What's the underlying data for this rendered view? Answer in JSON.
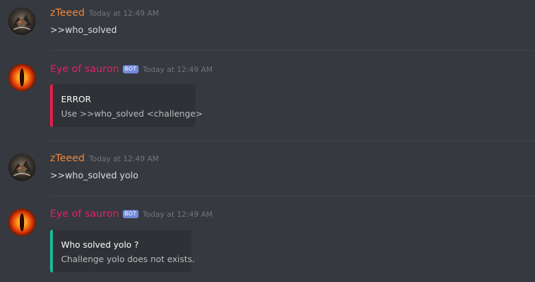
{
  "colors": {
    "background": "#36393f",
    "user_name": "#f0883d",
    "bot_name": "#e91e63",
    "bot_badge": "#7289da",
    "embed_error": "#e91e4c",
    "embed_info": "#1abc9c"
  },
  "messages": [
    {
      "author": "zTeeed",
      "avatar_icon": "dragon-avatar-icon",
      "timestamp": "Today at 12:49 AM",
      "text": ">>who_solved"
    },
    {
      "author": "Eye of sauron",
      "avatar_icon": "eye-of-sauron-avatar-icon",
      "badge": "BOT",
      "timestamp": "Today at 12:49 AM",
      "embed": {
        "title": "ERROR",
        "description": "Use >>who_solved <challenge>"
      }
    },
    {
      "author": "zTeeed",
      "avatar_icon": "dragon-avatar-icon",
      "timestamp": "Today at 12:49 AM",
      "text": ">>who_solved yolo"
    },
    {
      "author": "Eye of sauron",
      "avatar_icon": "eye-of-sauron-avatar-icon",
      "badge": "BOT",
      "timestamp": "Today at 12:49 AM",
      "embed": {
        "title": "Who solved yolo ?",
        "description": "Challenge yolo does not exists."
      }
    }
  ]
}
